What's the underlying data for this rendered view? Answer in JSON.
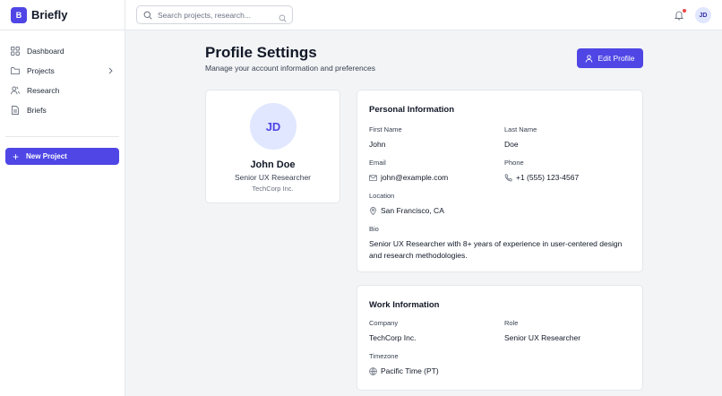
{
  "brand": {
    "logo_letter": "B",
    "name": "Briefly"
  },
  "sidebar": {
    "items": [
      {
        "label": "Dashboard",
        "icon": "grid-icon"
      },
      {
        "label": "Projects",
        "icon": "folder-icon",
        "has_chevron": true
      },
      {
        "label": "Research",
        "icon": "users-icon"
      },
      {
        "label": "Briefs",
        "icon": "document-icon"
      }
    ],
    "new_project_label": "New Project"
  },
  "topbar": {
    "search_placeholder": "Search projects, research...",
    "avatar_initials": "JD",
    "has_notification": true
  },
  "page": {
    "title": "Profile Settings",
    "subtitle": "Manage your account information and preferences",
    "edit_button_label": "Edit Profile"
  },
  "profile_card": {
    "initials": "JD",
    "name": "John Doe",
    "role": "Senior UX Researcher",
    "company": "TechCorp Inc."
  },
  "personal_info": {
    "title": "Personal Information",
    "first_name_label": "First Name",
    "first_name": "John",
    "last_name_label": "Last Name",
    "last_name": "Doe",
    "email_label": "Email",
    "email": "john@example.com",
    "phone_label": "Phone",
    "phone": "+1 (555) 123-4567",
    "location_label": "Location",
    "location": "San Francisco, CA",
    "bio_label": "Bio",
    "bio": "Senior UX Researcher with 8+ years of experience in user-centered design and research methodologies."
  },
  "work_info": {
    "title": "Work Information",
    "company_label": "Company",
    "company": "TechCorp Inc.",
    "role_label": "Role",
    "role": "Senior UX Researcher",
    "timezone_label": "Timezone",
    "timezone": "Pacific Time (PT)"
  },
  "colors": {
    "accent": "#4f46e5",
    "avatar_bg": "#e0e7ff",
    "notification_dot": "#ef4444",
    "page_bg": "#f3f4f6"
  }
}
